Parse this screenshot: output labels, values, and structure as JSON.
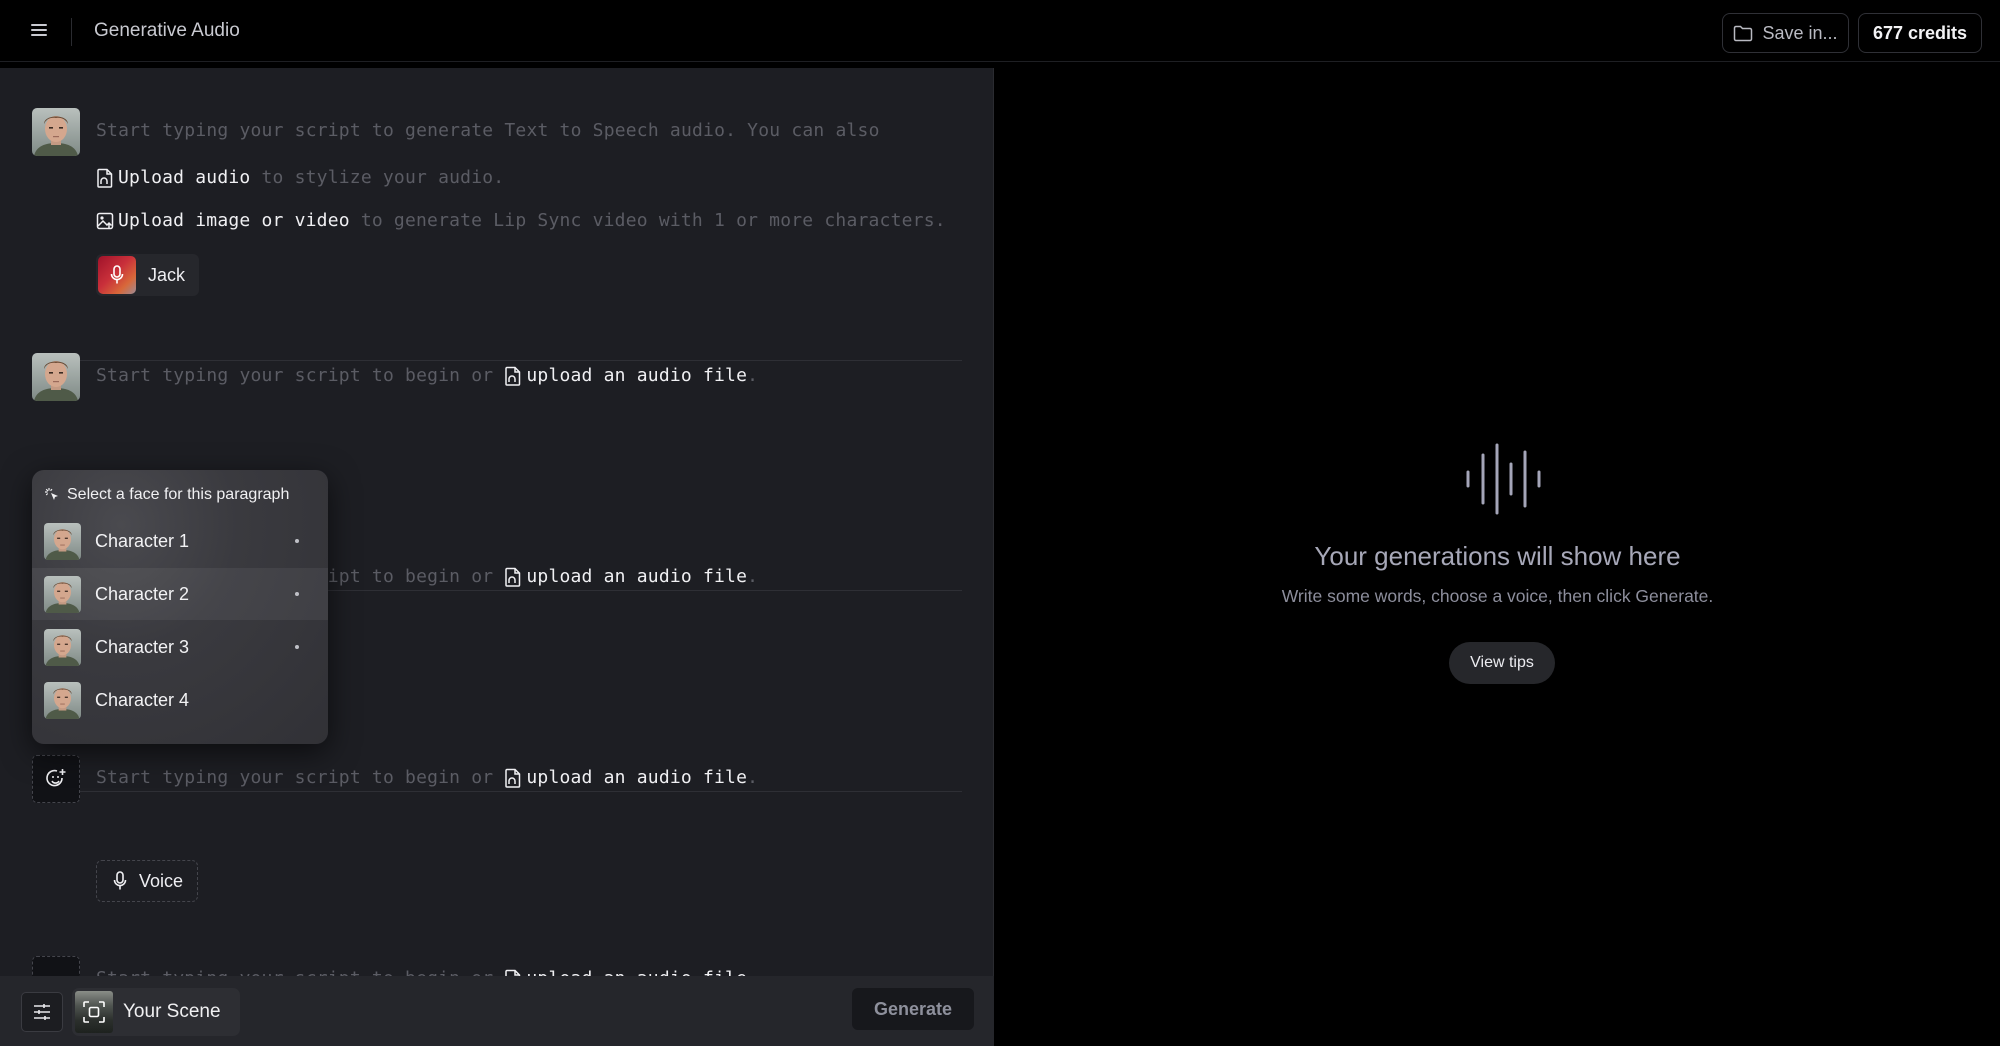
{
  "header": {
    "menu_icon": "hamburger-menu-icon",
    "title": "Generative Audio",
    "save_label": "Save in...",
    "save_icon": "folder-icon",
    "credits_label": "677 credits"
  },
  "editor": {
    "intro": {
      "placeholder": "Start typing your script to generate Text to Speech audio. You can also",
      "upload_audio_link": "Upload audio",
      "upload_audio_rest": " to stylize your audio.",
      "upload_media_link": "Upload image or video",
      "upload_media_rest": " to generate Lip Sync video with 1 or more characters."
    },
    "paragraphs": [
      {
        "face": "Character 1",
        "voice": "Jack"
      },
      {
        "placeholder": "Start typing your script to begin or ",
        "link": "upload an audio file",
        "tail": "."
      },
      {
        "placeholder": "Start typing your script to begin or ",
        "link": "upload an audio file",
        "tail": "."
      },
      {
        "placeholder": "Start typing your script to begin or ",
        "link": "upload an audio file",
        "tail": ".",
        "voice": "Voice"
      },
      {
        "placeholder": "Start typing your script to begin or ",
        "link": "upload an audio file",
        "tail": "."
      }
    ]
  },
  "face_menu": {
    "heading": "Select a face for this paragraph",
    "items": [
      {
        "label": "Character 1",
        "used": true
      },
      {
        "label": "Character 2",
        "used": true,
        "hovered": true
      },
      {
        "label": "Character 3",
        "used": true
      },
      {
        "label": "Character 4",
        "used": false
      }
    ]
  },
  "bottom_bar": {
    "scene_label": "Your Scene",
    "generate_label": "Generate"
  },
  "empty_state": {
    "icon": "sound-wave-icon",
    "title": "Your generations will show here",
    "subtitle": "Write some words, choose a voice, then click Generate.",
    "tips_label": "View tips"
  }
}
